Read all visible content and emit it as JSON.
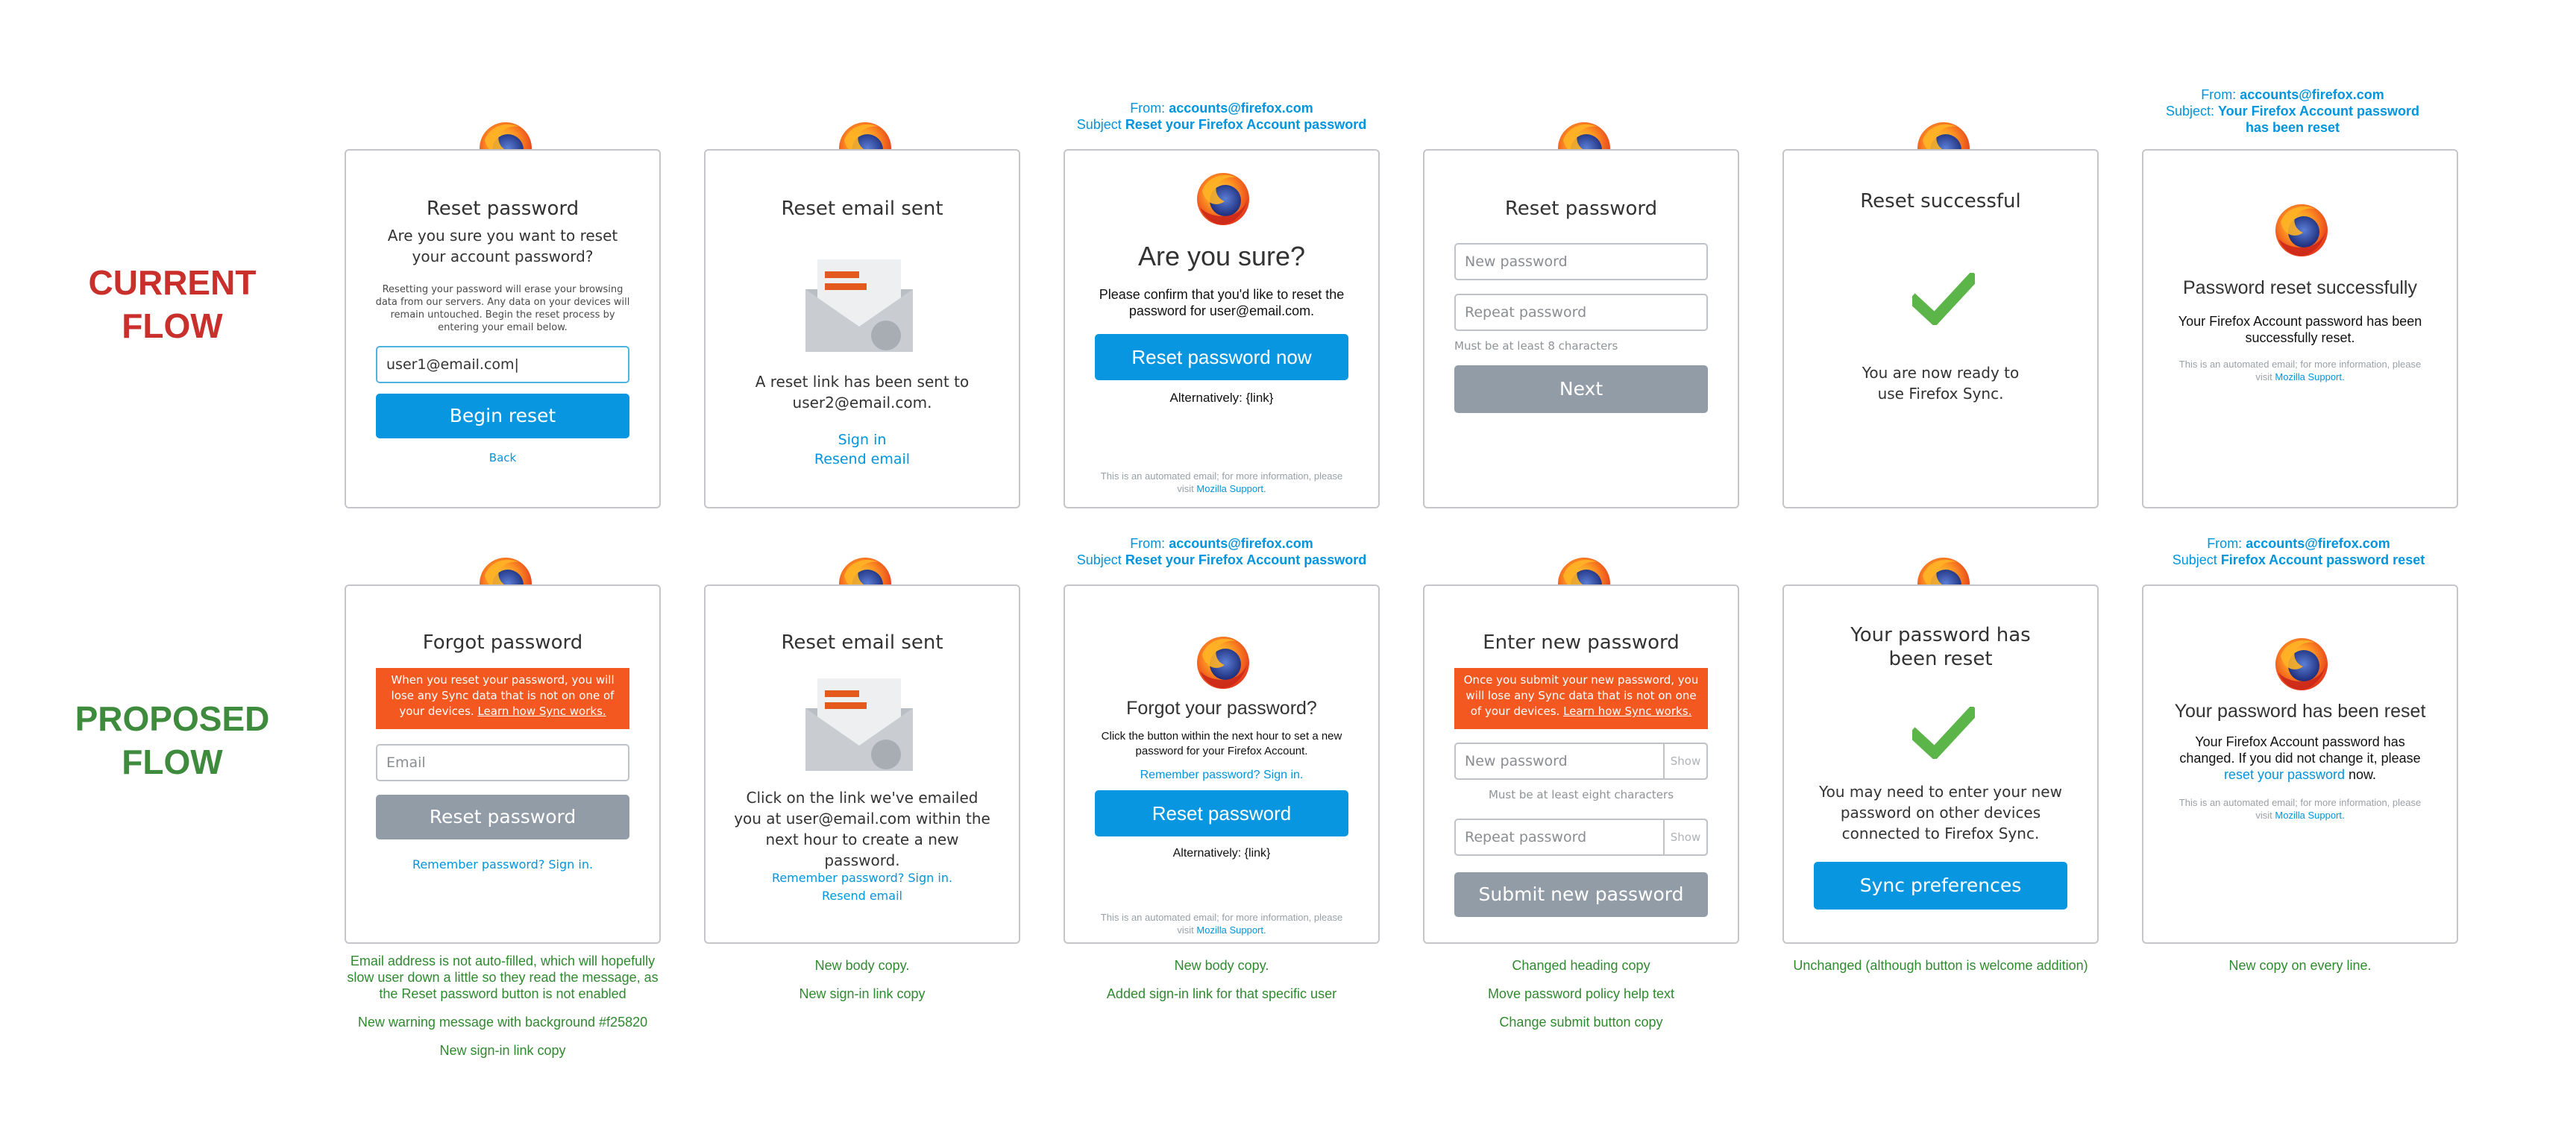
{
  "labels": {
    "current": "CURRENT\nFLOW",
    "proposed": "PROPOSED\nFLOW"
  },
  "colors": {
    "current": "#c9302c",
    "proposed": "#3e8b3e",
    "link": "#0095dd",
    "primary": "#0996e0",
    "disabled": "#929ca6",
    "warning": "#f25820",
    "check": "#5cb548"
  },
  "current": {
    "c1": {
      "title": "Reset password",
      "question": "Are you sure you want to reset your account password?",
      "body": "Resetting your password will erase your browsing data from our servers. Any data on your devices will remain untouched. Begin the reset process by entering your email below.",
      "email": "user1@email.com|",
      "button": "Begin reset",
      "back": "Back"
    },
    "c2": {
      "title": "Reset email sent",
      "body": "A reset link has been sent to user2@email.com.",
      "signin": "Sign in",
      "resend": "Resend email"
    },
    "c3": {
      "from_label": "From: ",
      "from": "accounts@firefox.com",
      "subject_label": "Subject ",
      "subject": "Reset your Firefox Account password",
      "title": "Are you sure?",
      "body": "Please confirm that you'd like to reset the password for user@email.com.",
      "button": "Reset password now",
      "alt": "Alternatively: {link}",
      "foot": "This is an automated email; for more information, please visit ",
      "foot_link": "Mozilla Support."
    },
    "c4": {
      "title": "Reset password",
      "new_ph": "New password",
      "repeat_ph": "Repeat password",
      "help": "Must be at least 8 characters",
      "button": "Next"
    },
    "c5": {
      "title": "Reset successful",
      "body": "You are now ready to use Firefox Sync."
    },
    "c6": {
      "from_label": "From: ",
      "from": "accounts@firefox.com",
      "subject_label": "Subject: ",
      "subject": "Your Firefox Account password has been reset",
      "title": "Password reset successfully",
      "body": "Your Firefox Account password has been successfully reset.",
      "foot": "This is an automated email; for more information, please visit ",
      "foot_link": "Mozilla Support."
    }
  },
  "proposed": {
    "p1": {
      "title": "Forgot password",
      "warning": "When you reset your password, you will lose any Sync data that is not on one of your devices. ",
      "warning_link": "Learn how Sync works.",
      "email_ph": "Email",
      "button": "Reset password",
      "signin": "Remember password? Sign in."
    },
    "p2": {
      "title": "Reset email sent",
      "body": "Click on the link we've emailed you at user@email.com within the next hour to create a new password.",
      "signin": "Remember password? Sign in.",
      "resend": "Resend email"
    },
    "p3": {
      "from_label": "From: ",
      "from": "accounts@firefox.com",
      "subject_label": "Subject ",
      "subject": "Reset your Firefox Account password",
      "title": "Forgot your password?",
      "body": "Click the button within the next hour to set a new password for your Firefox Account.",
      "signin": "Remember password? Sign in.",
      "button": "Reset password",
      "alt": "Alternatively: {link}",
      "foot": "This is an automated email; for more information, please visit ",
      "foot_link": "Mozilla Support."
    },
    "p4": {
      "title": "Enter new password",
      "warning": "Once you submit your new password, you will lose any Sync data that is not on one of your devices. ",
      "warning_link": "Learn how Sync works.",
      "new_ph": "New password",
      "repeat_ph": "Repeat password",
      "show": "Show",
      "help": "Must be at least eight characters",
      "button": "Submit new password"
    },
    "p5": {
      "title": "Your password has been reset",
      "body": "You may need to enter your new password on other devices connected to Firefox Sync.",
      "button": "Sync preferences"
    },
    "p6": {
      "from_label": "From: ",
      "from": "accounts@firefox.com",
      "subject_label": "Subject ",
      "subject": "Firefox Account password reset",
      "title": "Your password has been reset",
      "body_a": "Your Firefox Account password has changed. If you did not change it, please ",
      "body_link": "reset your password",
      "body_b": " now.",
      "foot": "This is an automated email; for more information, please visit ",
      "foot_link": "Mozilla Support."
    }
  },
  "notes": {
    "n1": [
      "Email address is not auto-filled, which will hopefully slow user down a little so they read the message, as the Reset password button is not enabled",
      "New warning message with background #f25820",
      "New sign-in link copy"
    ],
    "n2": [
      "New body copy.",
      "New sign-in link copy"
    ],
    "n3": [
      "New body copy.",
      "Added sign-in link for that specific user"
    ],
    "n4": [
      "Changed heading copy",
      "Move password policy help text",
      "Change submit button copy"
    ],
    "n5": [
      "Unchanged (although button is welcome addition)"
    ],
    "n6": [
      "New copy on every line."
    ]
  }
}
